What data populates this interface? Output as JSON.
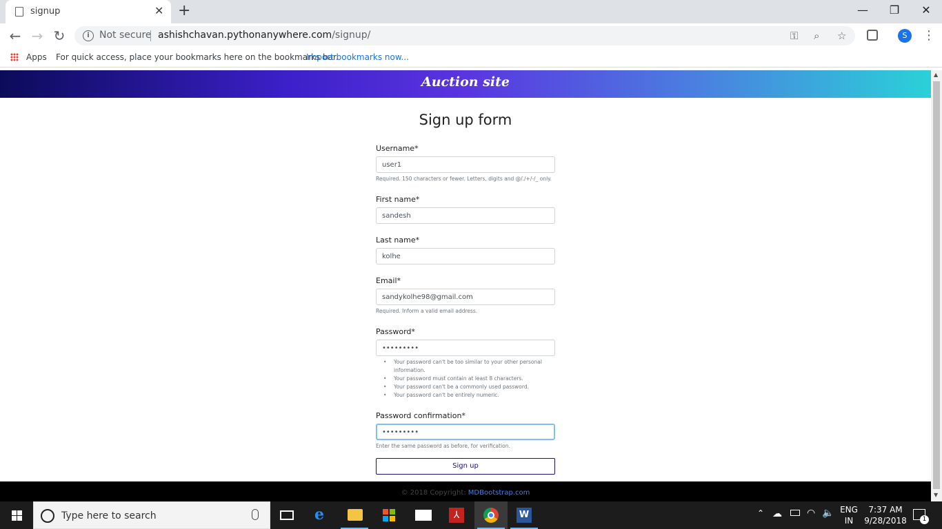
{
  "browser": {
    "tab_title": "signup",
    "security_label": "Not secure",
    "url_host": "ashishchavan.pythonanywhere.com",
    "url_path": "/signup/",
    "profile_initial": "S"
  },
  "bookmarks": {
    "apps_label": "Apps",
    "hint": "For quick access, place your bookmarks here on the bookmarks bar.",
    "import_link": "Import bookmarks now..."
  },
  "site": {
    "banner_title": "Auction site",
    "form_title": "Sign up form"
  },
  "form": {
    "username": {
      "label": "Username*",
      "value": "user1",
      "help": "Required. 150 characters or fewer. Letters, digits and @/./+/-/_ only."
    },
    "first_name": {
      "label": "First name*",
      "value": "sandesh"
    },
    "last_name": {
      "label": "Last name*",
      "value": "kolhe"
    },
    "email": {
      "label": "Email*",
      "value": "sandykolhe98@gmail.com",
      "help": "Required. Inform a valid email address."
    },
    "password": {
      "label": "Password*",
      "value": "•••••••••",
      "help": [
        "Your password can't be too similar to your other personal information.",
        "Your password must contain at least 8 characters.",
        "Your password can't be a commonly used password.",
        "Your password can't be entirely numeric."
      ]
    },
    "password_confirm": {
      "label": "Password confirmation*",
      "value": "•••••••••",
      "help": "Enter the same password as before, for verification."
    },
    "submit_label": "Sign up"
  },
  "footer": {
    "copyright": "© 2018 Copyright: ",
    "link": "MDBootstrap.com"
  },
  "taskbar": {
    "search_placeholder": "Type here to search",
    "language": "ENG",
    "region": "IN",
    "time": "7:37 AM",
    "date": "9/28/2018",
    "notification_count": "1"
  },
  "colors": {
    "banner_start": "#0b0b5a",
    "banner_end": "#2ad1d8",
    "link": "#1a73e8",
    "button_border": "#1a1070"
  }
}
